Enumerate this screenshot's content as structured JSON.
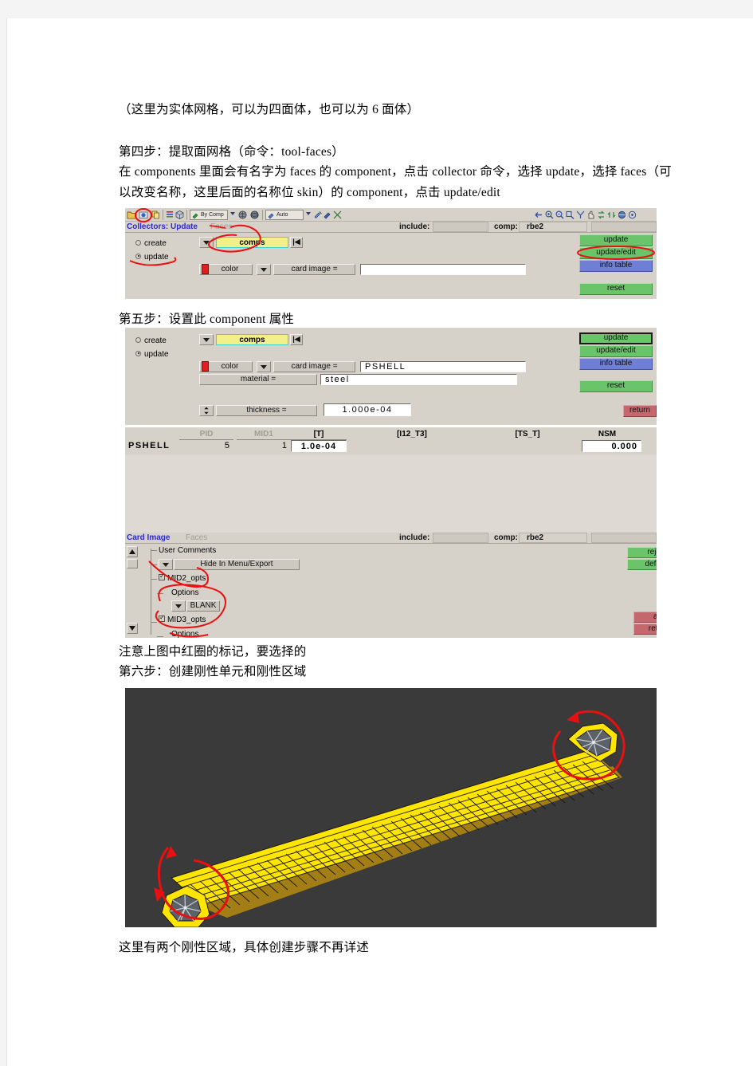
{
  "document": {
    "lines": [
      {
        "id": "l1",
        "text": "（这里为实体网格，可以为四面体，也可以为 6 面体）"
      },
      {
        "id": "l2",
        "text": "第四步：提取面网格（命令：tool-faces）"
      },
      {
        "id": "l3",
        "text": "在 components 里面会有名字为 faces 的 component，点击 collector 命令，选择 update，选择 faces（可以改变名称，这里后面的名称位 skin）的 component，点击 update/edit"
      },
      {
        "id": "l4",
        "text": "第五步：设置此 component 属性"
      },
      {
        "id": "l5",
        "text": "注意上图中红圈的标记，要选择的"
      },
      {
        "id": "l6",
        "text": "第六步：创建刚性单元和刚性区域"
      },
      {
        "id": "l7",
        "text": "这里有两个刚性区域，具体创建步骤不再详述"
      }
    ]
  },
  "panel1": {
    "toolbar": {
      "combo1_label": "By Comp",
      "combo2_label": "Auto",
      "icons": [
        "open-folder-icon",
        "component-color-icon",
        "copy-icon",
        "bars-icon",
        "cube-icon",
        "paint-bycomp-icon",
        "globe-icon",
        "sphere-icon",
        "auto-mesh-icon",
        "shrink-icon",
        "highlight-icon",
        "mask-icon"
      ],
      "right_icons": [
        "arrow-left-icon",
        "zoom-in-icon",
        "zoom-out-icon",
        "zoom-window-icon",
        "fit-icon",
        "hand-pan-icon",
        "rotate-icon",
        "rotate-alt-icon",
        "globe-rotate-icon",
        "view-icon"
      ]
    },
    "header": {
      "title": "Collectors: Update",
      "subtitle": "Faces",
      "include_label": "include:",
      "include_value": "",
      "comp_label": "comp:",
      "comp_value": "rbe2"
    },
    "mode": {
      "create_label": "create",
      "update_label": "update",
      "selected": "update"
    },
    "entity_selector": {
      "value": "comps",
      "rewind_glyph": "|◀"
    },
    "color_button": "color",
    "card_image_label": "card image =",
    "card_image_value": "",
    "buttons": {
      "update": "update",
      "update_edit": "update/edit",
      "info_table": "info table",
      "reset": "reset"
    },
    "annotations": [
      "circle-on-color-icon",
      "circle-on-update-radio",
      "circle-on-comps-field",
      "circle-on-update-edit-button"
    ]
  },
  "panel2": {
    "mode": {
      "create_label": "create",
      "update_label": "update",
      "selected": "update"
    },
    "entity_selector": {
      "value": "comps",
      "rewind_glyph": "|◀"
    },
    "color_button": "color",
    "card_image_label": "card image =",
    "card_image_value": "PSHELL",
    "material_label": "material =",
    "material_value": "steel",
    "thickness_label": "thickness =",
    "thickness_value": "1.000e-04",
    "buttons": {
      "update": "update",
      "update_edit": "update/edit",
      "info_table": "info table",
      "reset": "reset",
      "return": "return"
    }
  },
  "panel3": {
    "row_name": "PSHELL",
    "columns": [
      {
        "label": "PID",
        "dim": true,
        "value": "5"
      },
      {
        "label": "MID1",
        "dim": true,
        "value": "1"
      },
      {
        "label": "[T]",
        "dim": false,
        "value": "1.0e-04",
        "boxed": true
      },
      {
        "label": "[I12_T3]",
        "dim": false,
        "value": ""
      },
      {
        "label": "[TS_T]",
        "dim": false,
        "value": ""
      },
      {
        "label": "NSM",
        "dim": false,
        "value": "0.000",
        "boxed": true
      }
    ]
  },
  "panel4": {
    "header": {
      "title": "Card Image",
      "subtitle": "Faces",
      "include_label": "include:",
      "include_value": "",
      "comp_label": "comp:",
      "comp_value": "rbe2"
    },
    "tree": [
      {
        "label": "User Comments",
        "type": "text",
        "indent": 0
      },
      {
        "label": "Hide In Menu/Export",
        "type": "dropdown-button",
        "indent": 1
      },
      {
        "label": "MID2_opts",
        "type": "checkbox",
        "checked": true,
        "indent": 1
      },
      {
        "label": "Options",
        "type": "text",
        "indent": 2
      },
      {
        "label": "BLANK",
        "type": "dropdown-button-small",
        "indent": 2
      },
      {
        "label": "MID3_opts",
        "type": "checkbox",
        "checked": true,
        "indent": 1
      },
      {
        "label": "Options",
        "type": "text",
        "indent": 2
      }
    ],
    "buttons": {
      "reject": "reje",
      "default": "defa",
      "abort": "ab",
      "return": "retu"
    },
    "annotations": [
      "circle-on-MID2-opts",
      "circle-on-BLANK-MID3-opts"
    ]
  },
  "viewport": {
    "background_color": "#3a3a3a",
    "mesh_color": "#ffe500",
    "mesh_side_color": "#b8901c",
    "rigid_spider_color": "#b9bec7",
    "annotation_color": "#e81010",
    "annotations": [
      "circle-on-left-rigid-region",
      "circle-on-right-rigid-region"
    ],
    "rigid_region_count": 2
  },
  "colors": {
    "panel_bg": "#d6d2ca",
    "green": "#6ac46a",
    "blue": "#6f7fd6",
    "red": "#c4686e",
    "yellow_field": "#f2f08a",
    "title_blue": "#2b2bcc",
    "ink_red": "#e81010"
  }
}
